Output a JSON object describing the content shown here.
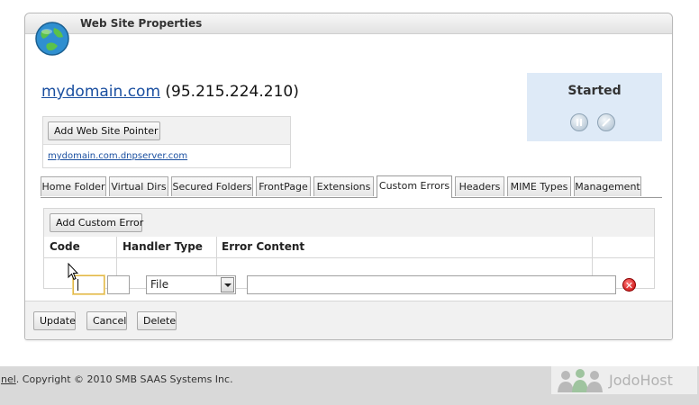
{
  "panel": {
    "title": "Web Site Properties"
  },
  "site": {
    "domain": "mydomain.com",
    "ip": "(95.215.224.210)"
  },
  "pointer": {
    "add_button": "Add Web Site Pointer",
    "link": "mydomain.com.dnpserver.com"
  },
  "status": {
    "text": "Started",
    "pause_icon": "pause-icon",
    "stop_icon": "stop-icon"
  },
  "tabs": [
    {
      "label": "Home Folder",
      "active": false
    },
    {
      "label": "Virtual Dirs",
      "active": false
    },
    {
      "label": "Secured Folders",
      "active": false
    },
    {
      "label": "FrontPage",
      "active": false
    },
    {
      "label": "Extensions",
      "active": false
    },
    {
      "label": "Custom Errors",
      "active": true
    },
    {
      "label": "Headers",
      "active": false
    },
    {
      "label": "MIME Types",
      "active": false
    },
    {
      "label": "Management",
      "active": false
    }
  ],
  "custom_errors": {
    "add_button": "Add Custom Error",
    "columns": [
      "Code",
      "Handler Type",
      "Error Content"
    ],
    "row": {
      "code": "",
      "subcode": "",
      "handler": "File",
      "content": "",
      "delete_icon": "delete-icon"
    }
  },
  "actions": {
    "update": "Update",
    "cancel": "Cancel",
    "delete": "Delete"
  },
  "footer": {
    "link_text": "nel",
    "copyright": ". Copyright © 2010 SMB SAAS Systems Inc.",
    "brand": "JodoHost"
  }
}
